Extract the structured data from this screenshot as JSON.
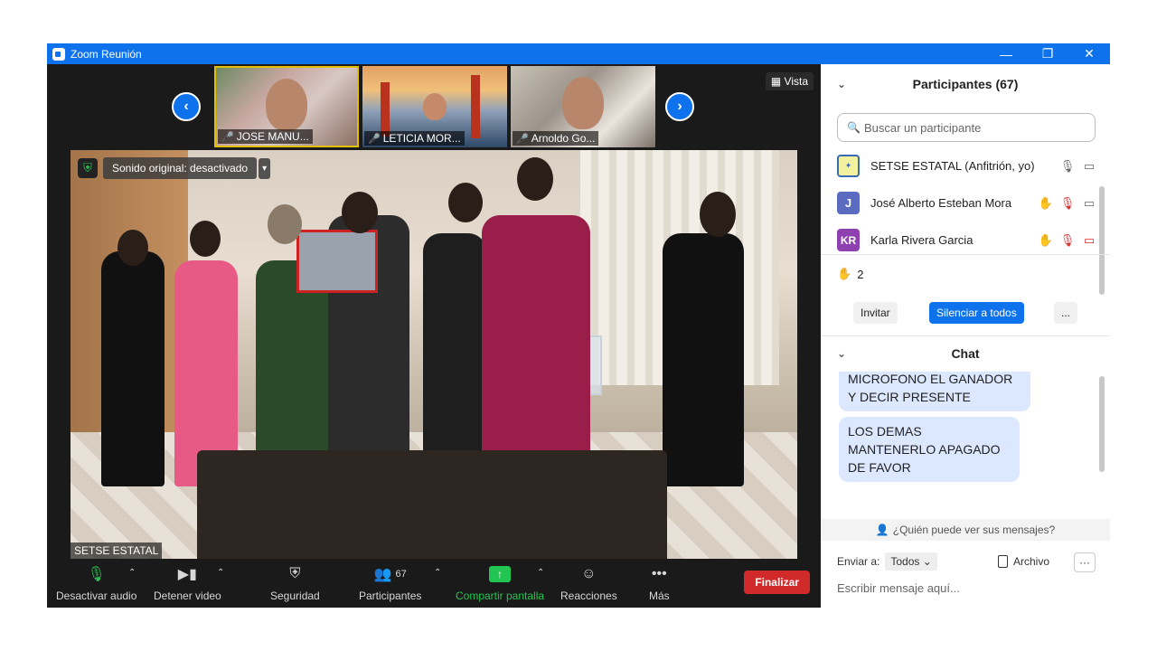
{
  "window": {
    "title": "Zoom Reunión",
    "minimize": "—",
    "restore": "❐",
    "close": "✕"
  },
  "thumbnails": [
    {
      "name": "JOSE MANU...",
      "muted": true
    },
    {
      "name": "LETICIA MOR...",
      "muted": true
    },
    {
      "name": "Arnoldo Go...",
      "muted": true
    }
  ],
  "view_button": "Vista",
  "main_video": {
    "sound_label": "Sonido original: desactivado",
    "speaker_name": "SETSE ESTATAL"
  },
  "toolbar": {
    "mute_label": "Desactivar audio",
    "video_label": "Detener video",
    "security_label": "Seguridad",
    "participants_label": "Participantes",
    "participants_count": "67",
    "share_label": "Compartir pantalla",
    "reactions_label": "Reacciones",
    "more_label": "Más",
    "end_label": "Finalizar"
  },
  "participants_panel": {
    "title": "Participantes (67)",
    "search_placeholder": "Buscar un participante",
    "participants": [
      {
        "initials": "",
        "name": "SETSE ESTATAL (Anfitrión, yo)",
        "hand": false
      },
      {
        "initials": "J",
        "name": "José Alberto Esteban Mora",
        "hand": true
      },
      {
        "initials": "KR",
        "name": "Karla Rivera Garcia",
        "hand": true
      }
    ],
    "raised_hands": "2",
    "invite_label": "Invitar",
    "mute_all_label": "Silenciar a todos",
    "more_label": "..."
  },
  "chat_panel": {
    "title": "Chat",
    "messages": [
      "MICROFONO EL GANADOR Y DECIR PRESENTE",
      "LOS DEMAS MANTENERLO APAGADO DE FAVOR"
    ],
    "who_can_see": "¿Quién puede ver sus mensajes?",
    "send_to_label": "Enviar a:",
    "send_to_value": "Todos",
    "file_label": "Archivo",
    "more_label": "···",
    "input_placeholder": "Escribir mensaje aquí..."
  },
  "colors": {
    "accent": "#0e72ed",
    "end_red": "#d02a2a",
    "share_green": "#23c552",
    "bubble": "#dbe8ff"
  }
}
